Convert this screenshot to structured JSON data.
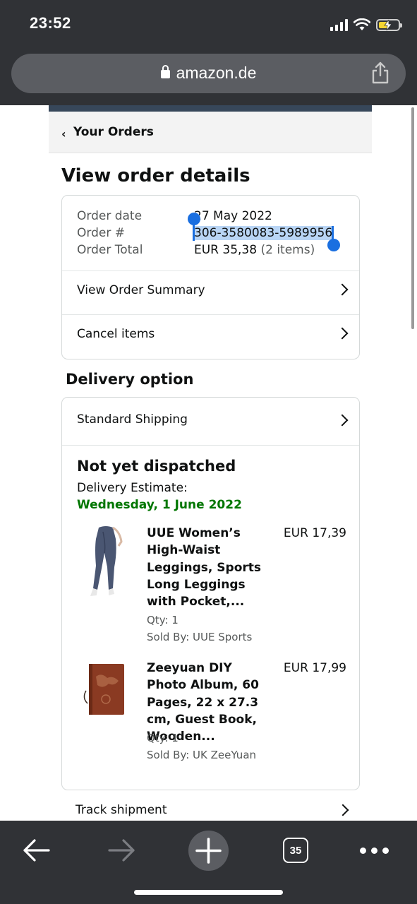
{
  "status_bar": {
    "time": "23:52"
  },
  "browser": {
    "domain": "amazon.de",
    "tab_count": "35"
  },
  "breadcrumb": {
    "chevron": "‹",
    "label": "Your Orders"
  },
  "page_title": "View order details",
  "order_info": {
    "date_label": "Order date",
    "date_value": "27 May 2022",
    "number_label": "Order #",
    "number_value": "306-3580083-5989956",
    "total_label": "Order Total",
    "total_value": "EUR 35,38",
    "total_items": "(2 items)"
  },
  "order_links": {
    "summary": "View Order Summary",
    "cancel": "Cancel items"
  },
  "delivery": {
    "section_title": "Delivery option",
    "shipping_method": "Standard Shipping",
    "status_title": "Not yet dispatched",
    "estimate_label": "Delivery Estimate:",
    "estimate_date": "Wednesday, 1 June 2022",
    "items": [
      {
        "name": "UUE Women’s High-Waist Leggings, Sports Long Leggings with Pocket,...",
        "price": "EUR 17,39",
        "qty": "Qty: 1",
        "seller": "Sold By: UUE Sports"
      },
      {
        "name": "Zeeyuan DIY Photo Album, 60 Pages, 22 x 27.3 cm, Guest Book, Wooden...",
        "price": "EUR 17,99",
        "qty": "Qty: 1",
        "seller": "Sold By: UK ZeeYuan"
      }
    ],
    "track_label": "Track shipment"
  },
  "colors": {
    "browser_chrome": "#303236",
    "estimate_green": "#007600",
    "selection_blue": "#1a6fe0",
    "nav_bar": "#37475a"
  }
}
